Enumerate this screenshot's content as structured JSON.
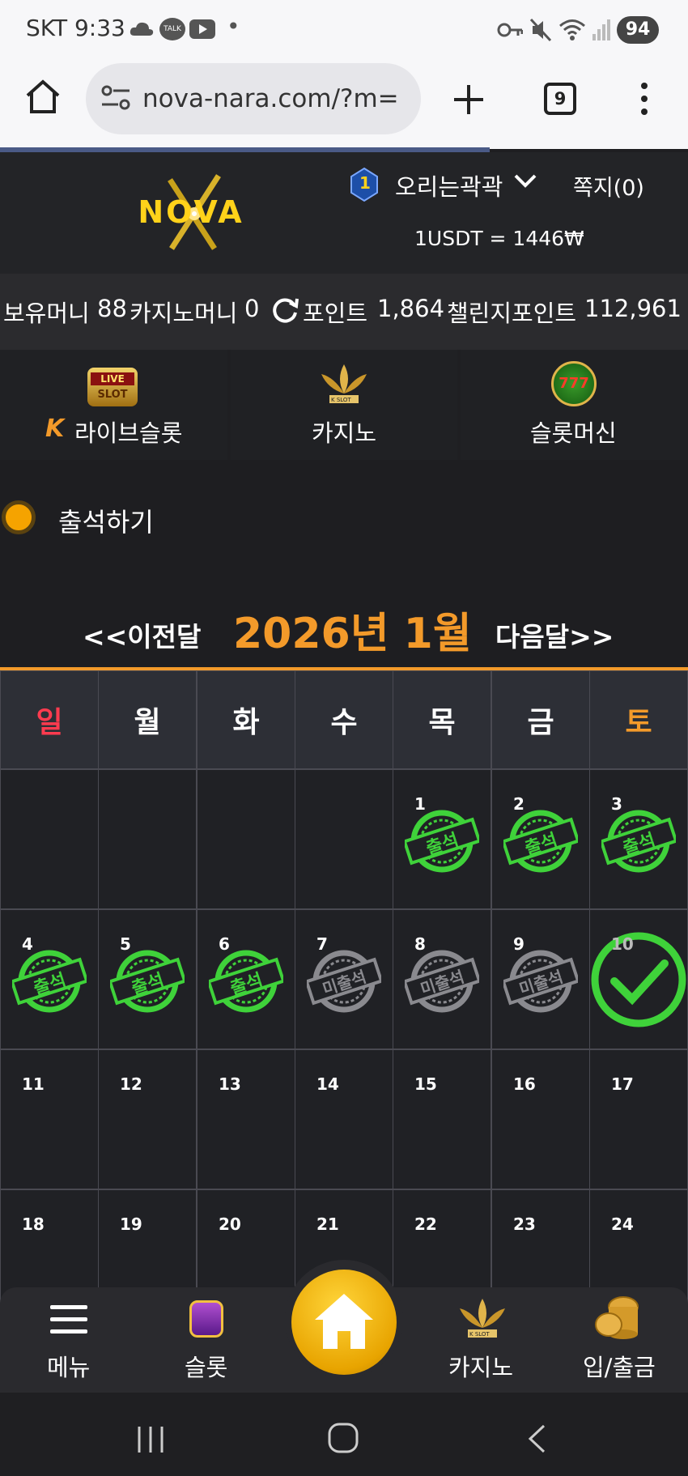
{
  "status_bar": {
    "carrier_time": "SKT 9:33",
    "talk": "TALK",
    "dot": "•",
    "battery": "94"
  },
  "browser": {
    "url": "nova-nara.com/?m=",
    "tab_count": "9"
  },
  "header": {
    "logo_text": "NOVA",
    "level_badge": "1",
    "username": "오리는곽곽",
    "messages": "쪽지(0)",
    "exchange_rate": "1USDT = 1446₩"
  },
  "money": {
    "holding_label": "보유머니",
    "holding_value": "88",
    "casino_label": "카지노머니",
    "casino_value": "0",
    "point_label": "포인트",
    "point_value": "1,864",
    "challenge_label": "챌린지포인트",
    "challenge_value": "112,961"
  },
  "game_tabs": [
    {
      "label": "라이브슬롯",
      "icon_caption_top": "LIVE",
      "icon_caption_bottom": "SLOT"
    },
    {
      "label": "카지노",
      "icon_caption": "K SLOT"
    },
    {
      "label": "슬롯머신",
      "icon_caption": "777"
    }
  ],
  "attendance": {
    "title": "출석하기",
    "prev_month": "<<이전달",
    "current_month": "2026년 1월",
    "next_month": "다음달>>",
    "weekdays": [
      "일",
      "월",
      "화",
      "수",
      "목",
      "금",
      "토"
    ],
    "weekday_colors": [
      "#ff3b4f",
      "#ffffff",
      "#ffffff",
      "#ffffff",
      "#ffffff",
      "#ffffff",
      "#f39a2a"
    ],
    "stamp_present": "출석",
    "stamp_absent": "미출석",
    "weeks": [
      [
        null,
        null,
        null,
        null,
        {
          "day": "1",
          "status": "present"
        },
        {
          "day": "2",
          "status": "present"
        },
        {
          "day": "3",
          "status": "present"
        }
      ],
      [
        {
          "day": "4",
          "status": "present"
        },
        {
          "day": "5",
          "status": "present"
        },
        {
          "day": "6",
          "status": "present"
        },
        {
          "day": "7",
          "status": "absent"
        },
        {
          "day": "8",
          "status": "absent"
        },
        {
          "day": "9",
          "status": "absent"
        },
        {
          "day": "10",
          "status": "today"
        }
      ],
      [
        {
          "day": "11"
        },
        {
          "day": "12"
        },
        {
          "day": "13"
        },
        {
          "day": "14"
        },
        {
          "day": "15"
        },
        {
          "day": "16"
        },
        {
          "day": "17"
        }
      ],
      [
        {
          "day": "18"
        },
        {
          "day": "19"
        },
        {
          "day": "20"
        },
        {
          "day": "21"
        },
        {
          "day": "22"
        },
        {
          "day": "23"
        },
        {
          "day": "24"
        }
      ]
    ]
  },
  "bottom_nav": {
    "menu": "메뉴",
    "slot": "슬롯",
    "casino": "카지노",
    "casino_icon_caption": "K SLOT",
    "deposit": "입/출금"
  },
  "colors": {
    "accent_orange": "#f39a2a",
    "stamp_green": "#3fd23a",
    "stamp_gray": "#8a8a8f"
  }
}
